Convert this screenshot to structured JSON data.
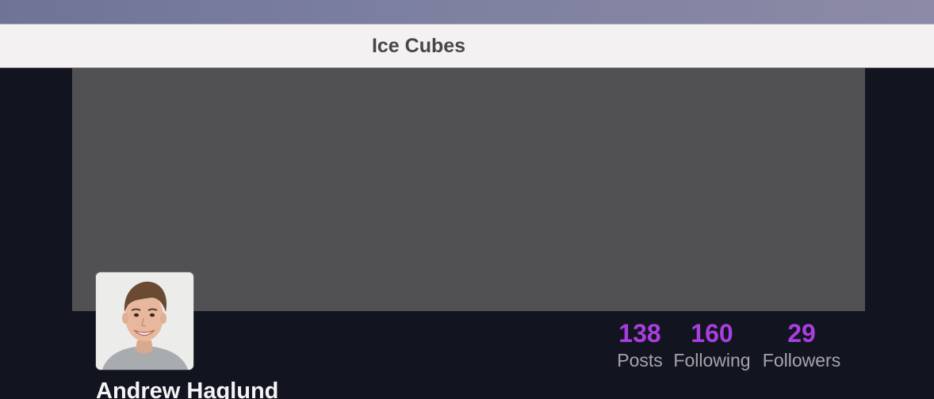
{
  "window": {
    "title": "Ice Cubes"
  },
  "profile": {
    "display_name": "Andrew Haglund",
    "avatar_icon": "person-photo",
    "stats": {
      "posts": {
        "value": "138",
        "label": "Posts"
      },
      "following": {
        "value": "160",
        "label": "Following"
      },
      "followers": {
        "value": "29",
        "label": "Followers"
      }
    }
  },
  "colors": {
    "accent": "#a93ee0",
    "background": "#121520",
    "banner": "#515153",
    "titlebar": "#f3f1f2"
  }
}
